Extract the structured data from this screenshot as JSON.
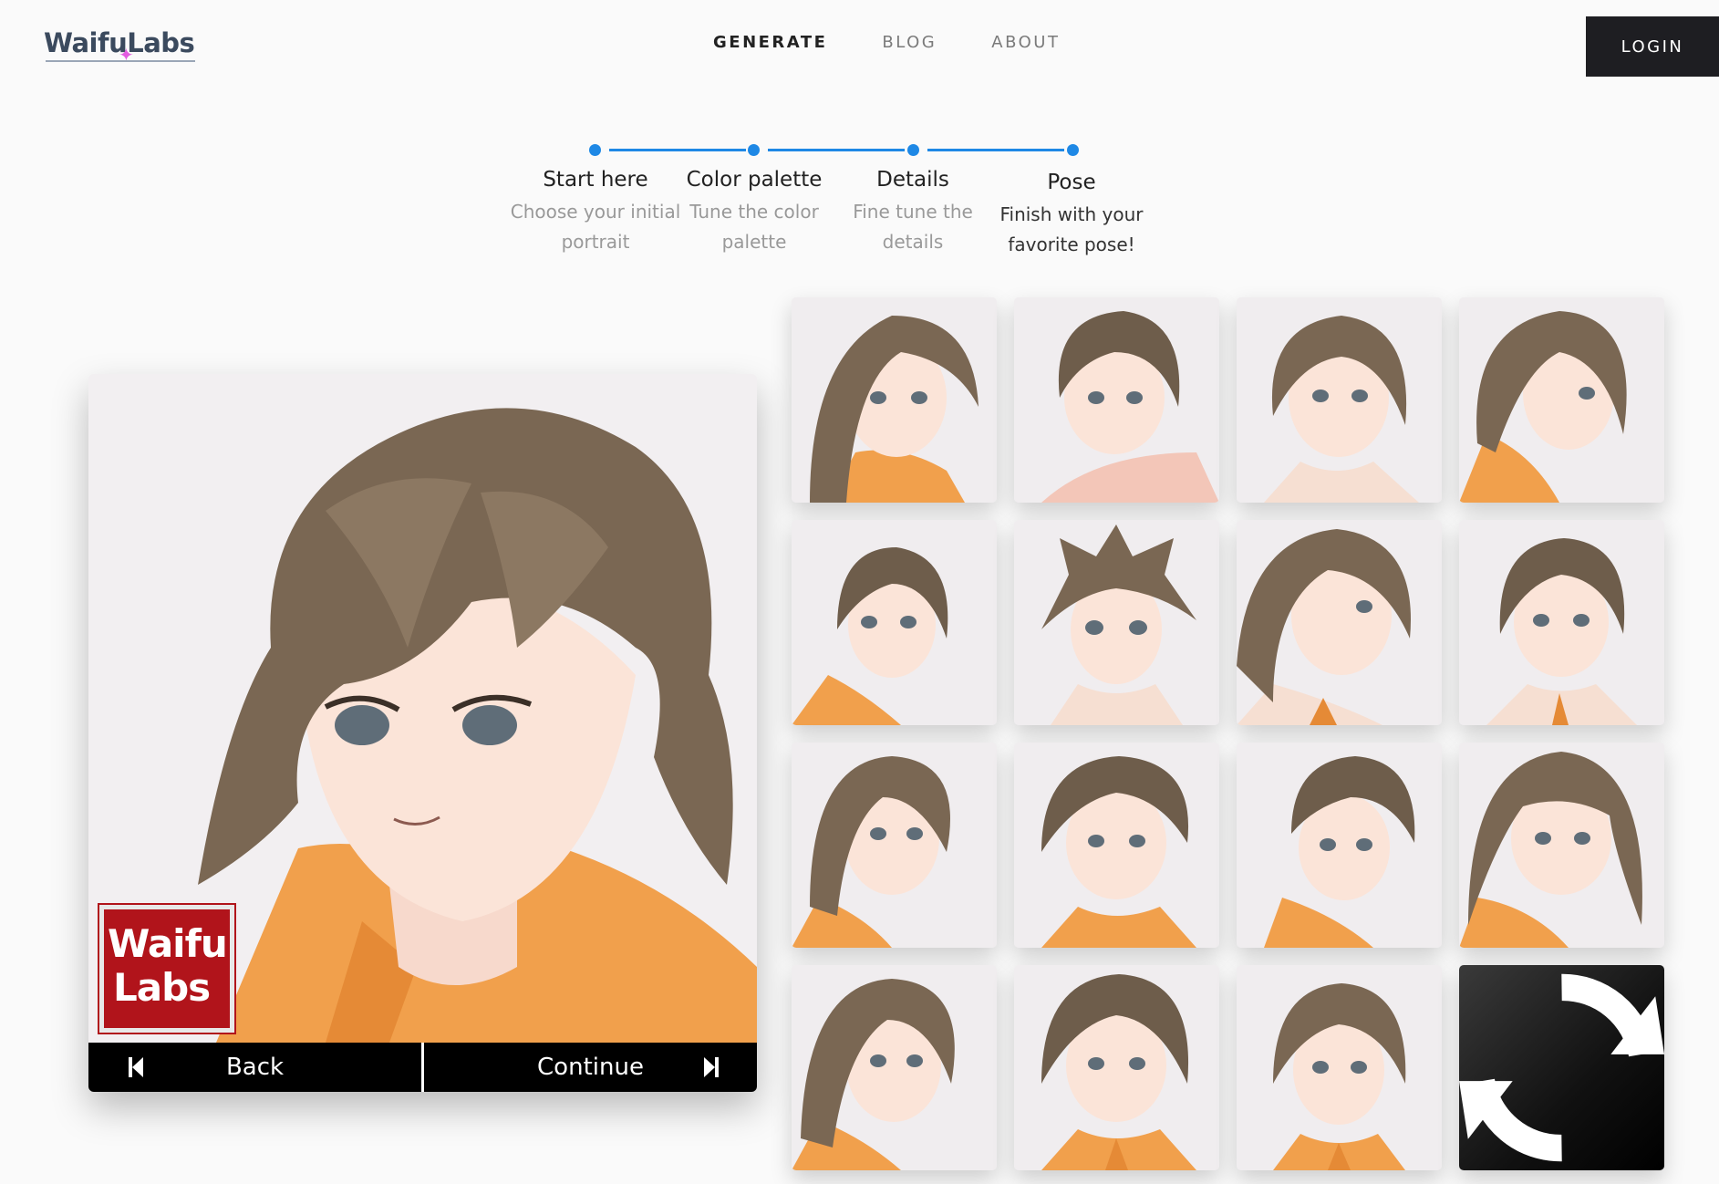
{
  "header": {
    "logo_text": "WaifuLabs",
    "nav": [
      {
        "label": "GENERATE",
        "active": true
      },
      {
        "label": "BLOG",
        "active": false
      },
      {
        "label": "ABOUT",
        "active": false
      }
    ],
    "login_label": "LOGIN"
  },
  "stepper": {
    "accent": "#1e88e5",
    "steps": [
      {
        "title": "Start here",
        "desc1": "Choose your initial",
        "desc2": "portrait"
      },
      {
        "title": "Color palette",
        "desc1": "Tune the color",
        "desc2": "palette"
      },
      {
        "title": "Details",
        "desc1": "Fine tune the",
        "desc2": "details"
      },
      {
        "title": "Pose",
        "desc1": "Finish with your",
        "desc2": "favorite pose!"
      }
    ]
  },
  "preview": {
    "badge_line1": "Waifu",
    "badge_line2": "Labs",
    "back_label": "Back",
    "continue_label": "Continue"
  },
  "grid": {
    "tile_count": 15,
    "refresh_icon": "refresh-icon"
  }
}
